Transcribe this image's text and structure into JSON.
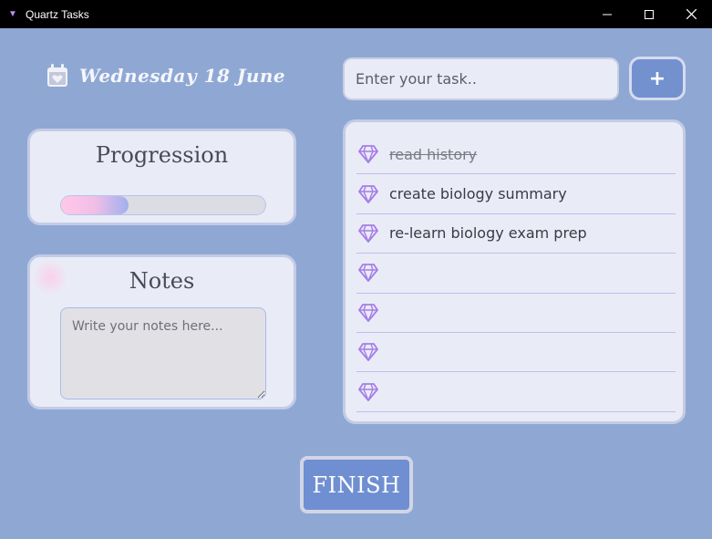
{
  "window": {
    "title": "Quartz Tasks"
  },
  "header": {
    "date": "Wednesday 18 June",
    "icon": "calendar-heart-icon"
  },
  "progress": {
    "title": "Progression",
    "value_fraction": 0.33
  },
  "notes": {
    "title": "Notes",
    "placeholder": "Write your notes here...",
    "value": ""
  },
  "task_input": {
    "placeholder": "Enter your task..",
    "value": "",
    "add_label": "+"
  },
  "tasks": [
    {
      "text": "read history",
      "done": true
    },
    {
      "text": "create biology summary",
      "done": false
    },
    {
      "text": "re-learn biology exam prep",
      "done": false
    },
    {
      "text": "",
      "done": false
    },
    {
      "text": "",
      "done": false
    },
    {
      "text": "",
      "done": false
    },
    {
      "text": "",
      "done": false
    }
  ],
  "finish": {
    "label": "FINISH"
  },
  "colors": {
    "background": "#8fa8d3",
    "card": "#e9ecf6",
    "accent": "#7391cf",
    "gem": "#a67de8"
  }
}
